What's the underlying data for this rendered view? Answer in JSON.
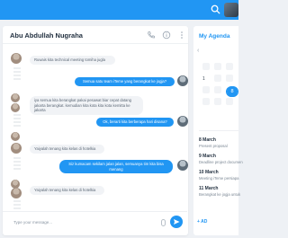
{
  "chat": {
    "contact_name": "Abu Abdullah Nugraha",
    "messages": [
      {
        "side": "in",
        "text": "Ruwais kita technical meeting tomiha jugla"
      },
      {
        "side": "out",
        "text": "Semua satu team iTeme yang berangkat ke jogja?"
      },
      {
        "side": "in",
        "text": "iya semua kita berangkat pakai pesawat biar cepat datang jakarta berangkat. kemudian kita kota kita kota kemitta ke jakarta"
      },
      {
        "side": "out",
        "text": "Ok, berarti kita berberapa hari disana?"
      },
      {
        "side": "in",
        "text": "Yaiyalah tenang kita kelas di hotelkia"
      },
      {
        "side": "out",
        "text": "Siz kumacam sekilam jalan jalan, semuanya tim kita bisa menang"
      },
      {
        "side": "in",
        "text": "Yaiyalah tenang kita kelas di hotelkia"
      }
    ],
    "input_placeholder": "Type your message..."
  },
  "agenda": {
    "title": "My Agenda",
    "calendar_rows": [
      [
        "",
        "",
        ""
      ],
      [
        "1",
        "",
        ""
      ],
      [
        "",
        "",
        ""
      ],
      [
        "",
        "",
        "8"
      ],
      [
        "",
        "",
        ""
      ],
      [
        "",
        "",
        ""
      ],
      [
        "",
        "",
        ""
      ]
    ],
    "events": [
      {
        "date": "8 March",
        "text": "Present proposal"
      },
      {
        "date": "9 March",
        "text": "Deadline project documen"
      },
      {
        "date": "10 March",
        "text": "Meeting iTeme persiapa"
      },
      {
        "date": "11 March",
        "text": "Berangkat ke jogja untuk"
      }
    ],
    "add_label": "+ AD"
  },
  "colors": {
    "accent": "#2196f3"
  }
}
